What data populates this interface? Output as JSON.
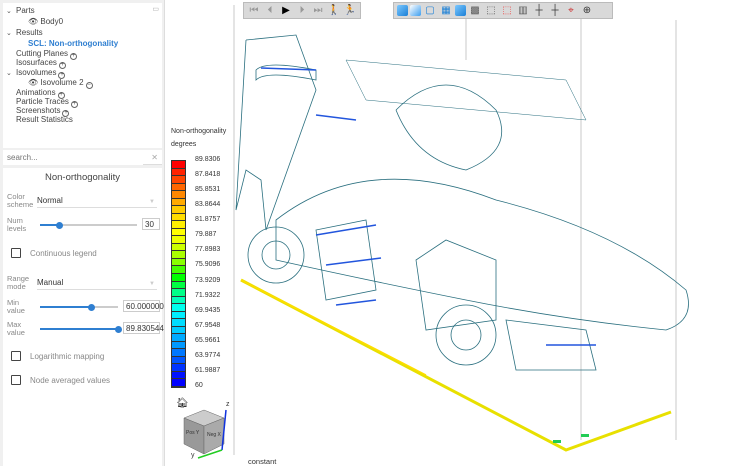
{
  "tree": {
    "parts": "Parts",
    "body0": "Body0",
    "results": "Results",
    "scl": "SCL: Non-orthogonality",
    "cutting_planes": "Cutting Planes",
    "isosurfaces": "Isosurfaces",
    "isovolumes": "Isovolumes",
    "isovolume2": "Isovolume 2",
    "animations": "Animations",
    "particle_traces": "Particle Traces",
    "screenshots": "Screenshots",
    "result_statistics": "Result Statistics"
  },
  "search": {
    "placeholder": "search..."
  },
  "props": {
    "title": "Non-orthogonality",
    "color_scheme_label": "Color scheme",
    "color_scheme_value": "Normal",
    "num_levels_label": "Num levels",
    "num_levels_value": "30",
    "num_levels_slider": 0.2,
    "continuous_legend": "Continuous legend",
    "continuous_legend_checked": false,
    "range_mode_label": "Range mode",
    "range_mode_value": "Manual",
    "min_label": "Min value",
    "min_value": "60.000000",
    "min_slider": 0.66,
    "max_label": "Max value",
    "max_value": "89.830544",
    "max_slider": 1.0,
    "log_mapping": "Logarithmic mapping",
    "log_checked": false,
    "node_averaged": "Node averaged values",
    "node_checked": false
  },
  "legend": {
    "title": "Non-orthogonality",
    "unit": "degrees",
    "labels": [
      "89.8306",
      "87.8418",
      "85.8531",
      "83.8644",
      "81.8757",
      "79.887",
      "77.8983",
      "75.9096",
      "73.9209",
      "71.9322",
      "69.9435",
      "67.9548",
      "65.9661",
      "63.9774",
      "61.9887",
      "60"
    ],
    "colors": [
      "#ff0000",
      "#ff2200",
      "#ff4400",
      "#ff6600",
      "#ff8800",
      "#ffaa00",
      "#ffcc00",
      "#ffdd00",
      "#ffee00",
      "#ffff00",
      "#eeff00",
      "#ccff00",
      "#aaff00",
      "#88ff00",
      "#44ff00",
      "#00ff00",
      "#00ff44",
      "#00ff88",
      "#00ffbb",
      "#00ffee",
      "#00eeff",
      "#00ddff",
      "#00ccff",
      "#00aaff",
      "#0099ff",
      "#0077ff",
      "#0055ff",
      "#0033ff",
      "#0011ff",
      "#0000ff"
    ]
  },
  "axes": {
    "z": "z",
    "y": "y",
    "pos_y": "Pos Y",
    "neg_x": "Neg X"
  },
  "footer_text": "constant",
  "toolbar_playback": [
    "first-icon",
    "prev-icon",
    "play-icon",
    "next-icon",
    "last-icon",
    "walk-icon",
    "run-icon"
  ],
  "toolbar_view": [
    "shaded-icon",
    "smooth-icon",
    "outline-icon",
    "mesh-icon",
    "shaded-edges-icon",
    "wireframe-icon",
    "feature-edges-icon",
    "hidden-icon",
    "box-icon",
    "probe-point-icon",
    "probe-element-icon",
    "measure-icon",
    "center-icon"
  ]
}
